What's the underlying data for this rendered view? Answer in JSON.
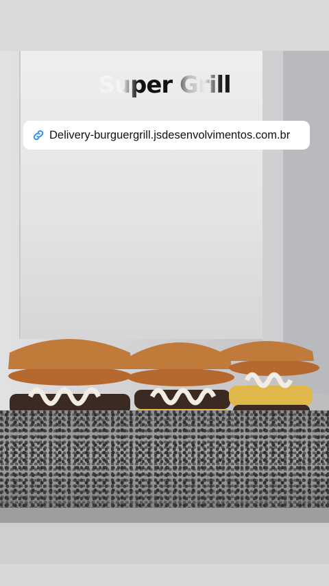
{
  "story": {
    "title": "Super Grill",
    "link": {
      "icon": "link-icon",
      "text": "Delivery-burguergrill.jsdesenvolvimentos.com.br"
    }
  },
  "colors": {
    "link_icon": "#2f8ff0",
    "sticker_bg": "#ffffff"
  }
}
